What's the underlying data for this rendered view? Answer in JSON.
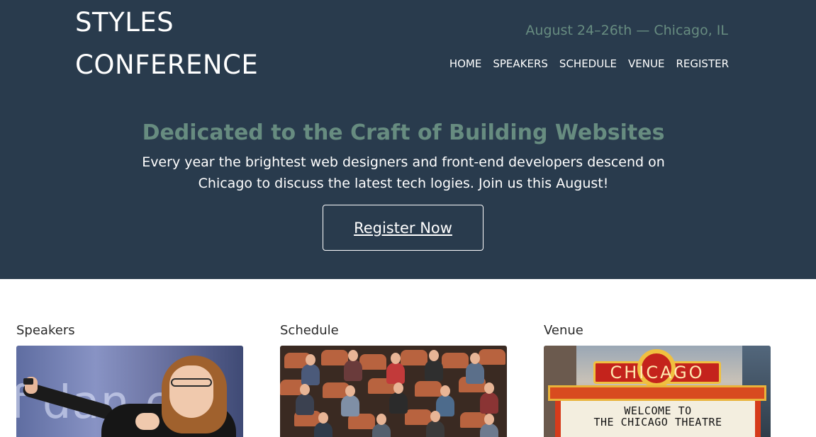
{
  "site": {
    "logo_line1": "STYLES",
    "logo_line2": "CONFERENCE",
    "date_location": "August 24–26th — Chicago, IL"
  },
  "nav": {
    "items": [
      "HOME",
      "SPEAKERS",
      "SCHEDULE",
      "VENUE",
      "REGISTER"
    ]
  },
  "hero": {
    "title": "Dedicated to the Craft of Building Websites",
    "lead": "Every year the brightest web designers and front-end developers descend on Chicago to discuss the latest tech logies. Join us this August!",
    "cta_label": "Register Now"
  },
  "sections": [
    {
      "title": "Speakers",
      "image": "speaker-photo",
      "image_text": "f dan e"
    },
    {
      "title": "Schedule",
      "image": "audience-photo"
    },
    {
      "title": "Venue",
      "image": "chicago-theatre-photo",
      "sign_text": "CHICAGO",
      "marquee_line1": "WELCOME TO",
      "marquee_line2": "THE CHICAGO THEATRE"
    }
  ],
  "colors": {
    "header_bg": "#293b4d",
    "accent": "#678c80",
    "text_light": "#ffffff",
    "text_dark": "#2a2a2a"
  }
}
